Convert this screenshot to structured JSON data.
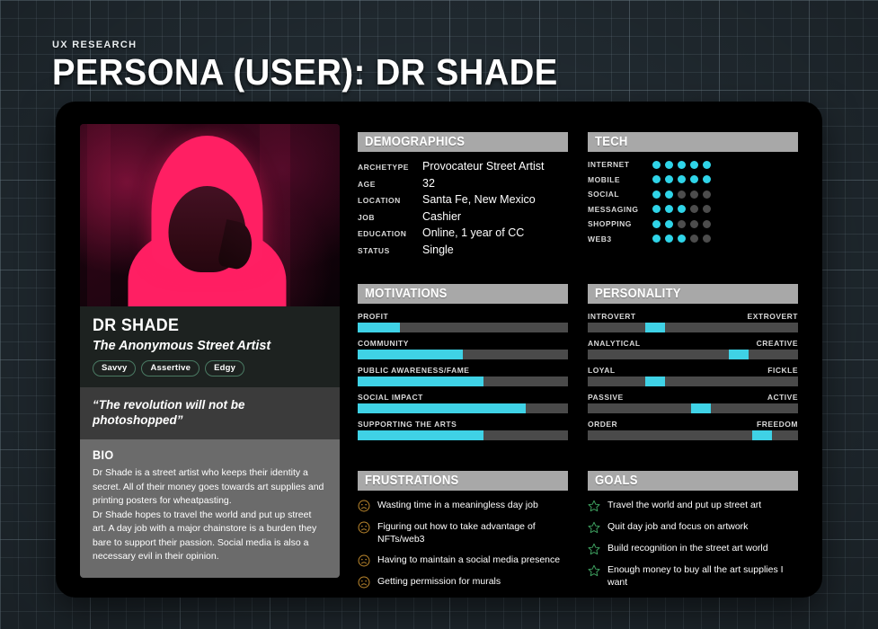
{
  "header": {
    "eyebrow": "UX RESEARCH",
    "title": "PERSONA (USER): DR SHADE"
  },
  "persona": {
    "portrait_alt": "hooded-figure-portrait",
    "name": "DR SHADE",
    "tagline": "The Anonymous Street Artist",
    "tags": [
      "Savvy",
      "Assertive",
      "Edgy"
    ],
    "quote": "“The revolution will not be photoshopped”",
    "bio_heading": "BIO",
    "bio_paragraphs": [
      "Dr Shade is a street artist who keeps their identity a secret.  All of their money goes towards art supplies and printing posters for wheatpasting.",
      "Dr Shade hopes to travel the world and put up street art.  A day job with a major chainstore is a burden they bare to support their passion.  Social media is also a necessary evil in their opinion."
    ]
  },
  "demographics": {
    "title": "DEMOGRAPHICS",
    "rows": [
      {
        "label": "ARCHETYPE",
        "value": "Provocateur Street Artist"
      },
      {
        "label": "AGE",
        "value": "32"
      },
      {
        "label": "LOCATION",
        "value": "Santa Fe, New Mexico"
      },
      {
        "label": "JOB",
        "value": "Cashier"
      },
      {
        "label": "EDUCATION",
        "value": "Online, 1 year of CC"
      },
      {
        "label": "STATUS",
        "value": "Single"
      }
    ]
  },
  "tech": {
    "title": "TECH",
    "max": 5,
    "rows": [
      {
        "label": "INTERNET",
        "value": 5
      },
      {
        "label": "MOBILE",
        "value": 5
      },
      {
        "label": "SOCIAL",
        "value": 2
      },
      {
        "label": "MESSAGING",
        "value": 3
      },
      {
        "label": "SHOPPING",
        "value": 2
      },
      {
        "label": "WEB3",
        "value": 3
      }
    ]
  },
  "motivations": {
    "title": "MOTIVATIONS",
    "rows": [
      {
        "label": "PROFIT",
        "percent": 20
      },
      {
        "label": "COMMUNITY",
        "percent": 50
      },
      {
        "label": "PUBLIC AWARENESS/FAME",
        "percent": 60
      },
      {
        "label": "SOCIAL IMPACT",
        "percent": 80
      },
      {
        "label": "SUPPORTING THE ARTS",
        "percent": 60
      }
    ]
  },
  "personality": {
    "title": "PERSONALITY",
    "rows": [
      {
        "left": "INTROVERT",
        "right": "EXTROVERT",
        "percent": 32
      },
      {
        "left": "ANALYTICAL",
        "right": "CREATIVE",
        "percent": 72
      },
      {
        "left": "LOYAL",
        "right": "FICKLE",
        "percent": 32
      },
      {
        "left": "PASSIVE",
        "right": "ACTIVE",
        "percent": 54
      },
      {
        "left": "ORDER",
        "right": "FREEDOM",
        "percent": 83
      }
    ]
  },
  "frustrations": {
    "title": "FRUSTRATIONS",
    "icon": "frowning-face-icon",
    "icon_color": "#c08a2e",
    "items": [
      "Wasting time in a meaningless day job",
      "Figuring out how to take advantage of NFTs/web3",
      "Having to maintain a social media presence",
      "Getting permission for murals"
    ]
  },
  "goals": {
    "title": "GOALS",
    "icon": "star-outline-icon",
    "icon_color": "#3d9e5e",
    "items": [
      "Travel the world and put up street art",
      "Quit day job and focus on artwork",
      "Build recognition in the street art world",
      "Enough money to buy all the art supplies I want"
    ]
  },
  "colors": {
    "accent_cyan": "#3fd2e6",
    "panel_header_gray": "#a8a8a8",
    "track_gray": "#4a4a4a",
    "card_black": "#000000",
    "background_slate": "#2e3b44",
    "portrait_pink": "#ff1f63"
  }
}
